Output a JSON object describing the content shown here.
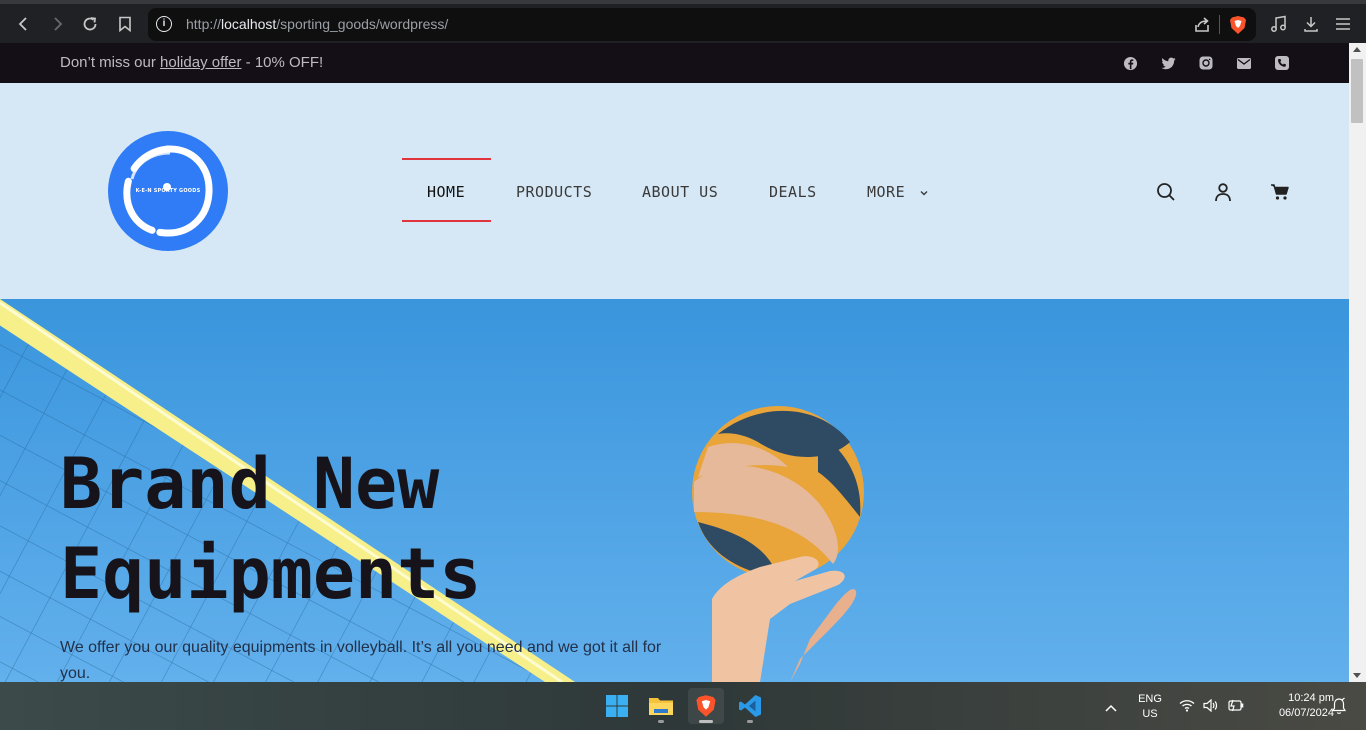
{
  "browser": {
    "url_prefix": "http://",
    "url_host": "localhost",
    "url_path": "/sporting_goods/wordpress/"
  },
  "topbar": {
    "offer_prefix": "Don’t miss our ",
    "offer_link": "holiday offer",
    "offer_suffix": " - 10% OFF!",
    "social_icons": [
      "facebook-icon",
      "twitter-icon",
      "instagram-icon",
      "mail-icon",
      "phone-icon"
    ]
  },
  "header": {
    "logo_text": "K-E-N SPORTY GOODS",
    "nav": [
      {
        "label": "HOME",
        "active": true
      },
      {
        "label": "PRODUCTS",
        "active": false
      },
      {
        "label": "ABOUT US",
        "active": false
      },
      {
        "label": "DEALS",
        "active": false
      },
      {
        "label": "MORE",
        "active": false
      }
    ],
    "accent_color": "#e0353d"
  },
  "hero": {
    "title_line1": "Brand New",
    "title_line2": "Equipments",
    "subtitle": "We offer you our quality equipments in volleyball. It’s all you need and we got it all for you."
  },
  "taskbar": {
    "apps": [
      "windows-start-icon",
      "file-explorer-icon",
      "brave-browser-icon",
      "vscode-icon"
    ],
    "lang_line1": "ENG",
    "lang_line2": "US",
    "time": "10:24 pm",
    "date": "06/07/2024"
  }
}
